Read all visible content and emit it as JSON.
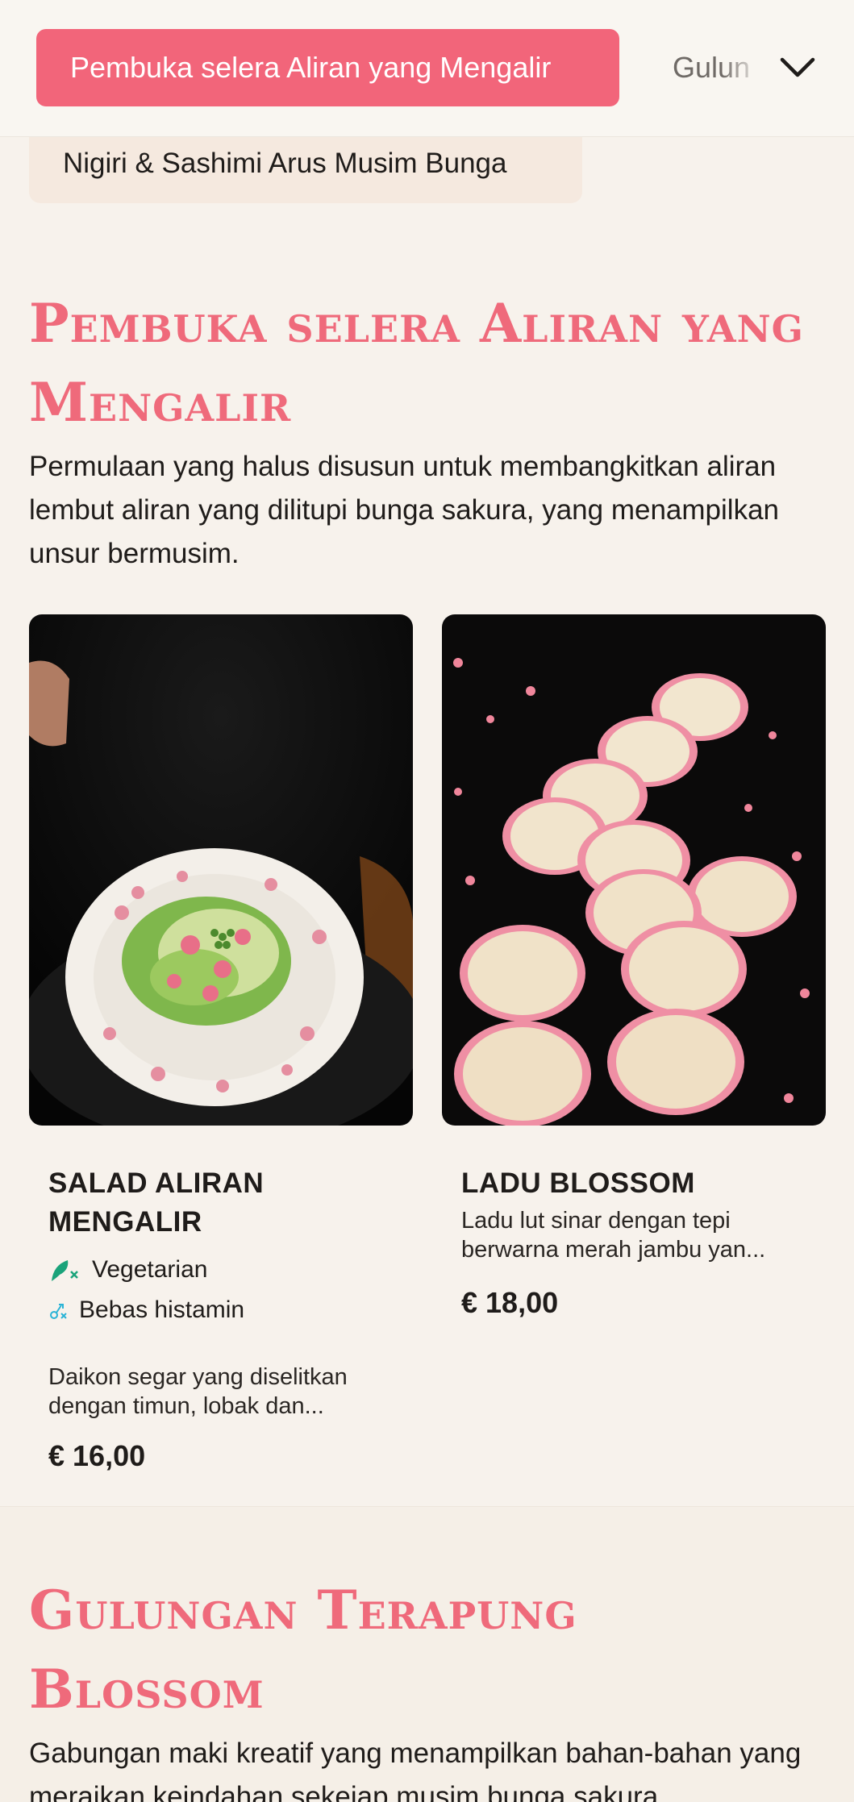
{
  "nav": {
    "active_tab": "Pembuka selera Aliran yang Mengalir",
    "next_tab": "Gulun",
    "prev_category": "Nigiri & Sashimi Arus Musim Bunga"
  },
  "section1": {
    "title": "Pembuka selera Aliran yang Mengalir",
    "description": "Permulaan yang halus disusun untuk membangkitkan aliran lembut aliran yang dilitupi bunga sakura, yang menampilkan unsur bermusim."
  },
  "items": [
    {
      "name": "SALAD ALIRAN MENGALIR",
      "tags": [
        {
          "label": "Vegetarian",
          "icon": "vegetarian-icon",
          "color": "#1aa37a"
        },
        {
          "label": "Bebas histamin",
          "icon": "histamine-free-icon",
          "color": "#29b3d6"
        }
      ],
      "description": "Daikon segar yang diselitkan dengan timun, lobak dan...",
      "price": "€ 16,00"
    },
    {
      "name": "LADU BLOSSOM",
      "description": "Ladu lut sinar dengan tepi berwarna merah jambu yan...",
      "price": "€ 18,00"
    }
  ],
  "section2": {
    "title": "Gulungan Terapung Blossom",
    "description": "Gabungan maki kreatif yang menampilkan bahan-bahan yang meraikan keindahan sekejap musim bunga sakura."
  },
  "colors": {
    "accent": "#f2657a",
    "heading": "#ef6a7b",
    "background": "#f7f2ec"
  }
}
